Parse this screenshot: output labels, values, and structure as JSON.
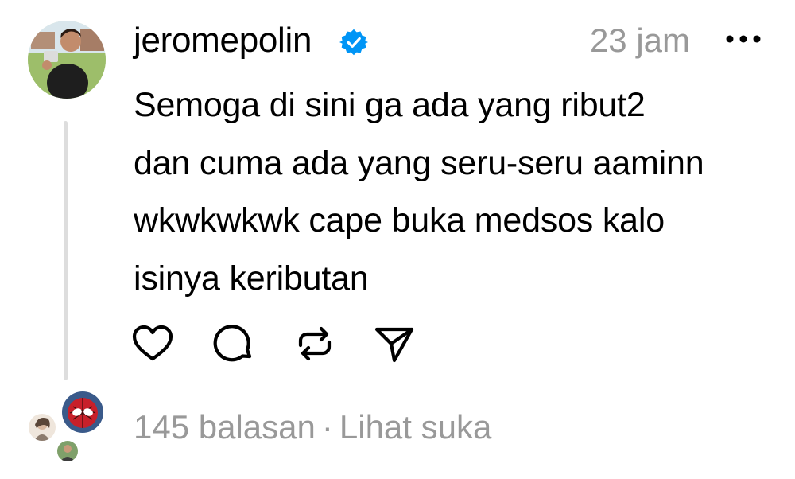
{
  "post": {
    "username": "jeromepolin",
    "timestamp": "23 jam",
    "text": "Semoga di sini ga ada yang ribut2\ndan cuma ada yang seru-seru aaminn\nwkwkwkwk cape buka medsos kalo\nisinya keributan"
  },
  "icons": {
    "verified": "verified-badge-icon",
    "more": "more-options-icon",
    "like": "heart-icon",
    "reply": "comment-icon",
    "repost": "repost-icon",
    "share": "send-icon"
  },
  "footer": {
    "replies": "145 balasan",
    "separator": "·",
    "likes_link": "Lihat suka"
  },
  "colors": {
    "verified": "#0095f6",
    "muted": "#999999",
    "thread_line": "#dddddd"
  }
}
